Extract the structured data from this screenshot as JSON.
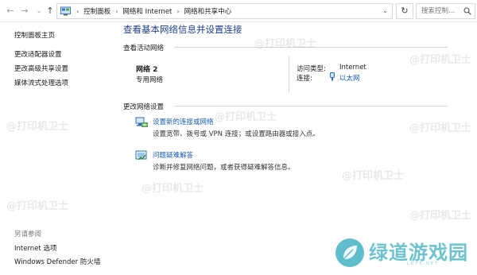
{
  "address_bar": {
    "breadcrumbs": [
      "控制面板",
      "网络和 Internet",
      "网络和共享中心"
    ],
    "search_placeholder": "搜索控制..."
  },
  "sidebar": {
    "items": [
      {
        "label": "控制面板主页"
      },
      {
        "label": "更改适配器设置"
      },
      {
        "label": "更改高级共享设置"
      },
      {
        "label": "媒体流式处理选项"
      }
    ],
    "see_also_heading": "另请参阅",
    "see_also": [
      {
        "label": "Internet 选项"
      },
      {
        "label": "Windows Defender 防火墙"
      }
    ]
  },
  "main": {
    "title": "查看基本网络信息并设置连接",
    "active_networks_heading": "查看活动网络",
    "network": {
      "name": "网络 2",
      "type": "专用网络",
      "access_type_label": "访问类型:",
      "access_type_value": "Internet",
      "connections_label": "连接:",
      "connections_value": "以太网"
    },
    "change_settings_heading": "更改网络设置",
    "tasks": [
      {
        "icon": "new-connection-icon",
        "link": "设置新的连接或网络",
        "desc": "设置宽带、拨号或 VPN 连接；或设置路由器或接入点。"
      },
      {
        "icon": "troubleshoot-icon",
        "link": "问题疑难解答",
        "desc": "诊断并修复网络问题，或者获得疑难解答信息。"
      }
    ]
  },
  "watermark": {
    "text": "@打印机卫士"
  },
  "brand": {
    "name": "绿道游戏园",
    "sub": "LDYS.NET"
  },
  "colors": {
    "link": "#1a5cb0",
    "title": "#1e3f8a",
    "brand": "#56b9c6"
  }
}
